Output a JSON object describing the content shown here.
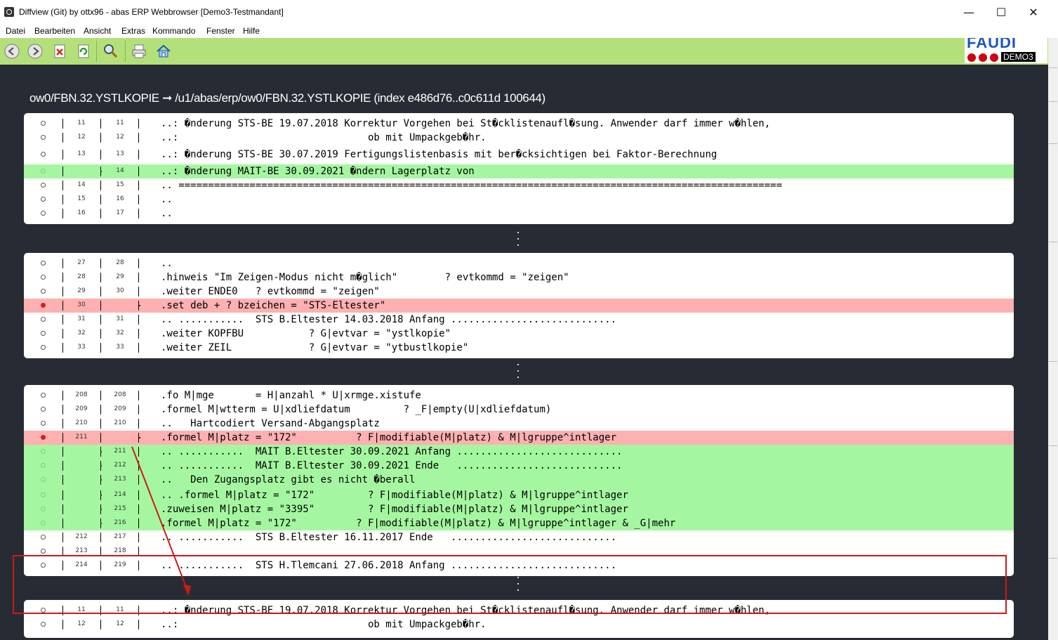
{
  "window": {
    "title": "Diffview (Git) by ottx96 - abas ERP Webbrowser  [Demo3-Testmandant]",
    "minimize_glyph": "—",
    "maximize_glyph": "☐",
    "close_glyph": "✕"
  },
  "menu": [
    "Datei",
    "Bearbeiten",
    "Ansicht",
    "Extras",
    "Kommando",
    "Fenster",
    "Hilfe"
  ],
  "toolbar": {
    "buttons": [
      "back-icon",
      "forward-icon",
      "delete-document-icon",
      "refresh-icon",
      "search-icon",
      "print-icon",
      "home-icon"
    ],
    "logo_text": "FAUDI",
    "logo_badge": "DEMO3"
  },
  "diff": {
    "title": "ow0/FBN.32.YSTLKOPIE ➞ /u1/abas/erp/ow0/FBN.32.YSTLKOPIE (index e486d76..c0c611d 100644)",
    "hunks": [
      {
        "lines": [
          {
            "type": "ctx",
            "old": "11",
            "new": "11",
            "code": "..: �nderung STS-BE 19.07.2018 Korrektur Vorgehen bei St�cklistenaufl�sung. Anwender darf immer w�hlen,"
          },
          {
            "type": "ctx",
            "old": "12",
            "new": "12",
            "code": "..:                                ob mit Umpackgeb�hr."
          },
          {
            "type": "ctx",
            "old": "13",
            "new": "13",
            "code": "..: �nderung STS-BE 30.07.2019 Fertigungslistenbasis mit ber�cksichtigen bei Faktor-Berechnung"
          },
          {
            "type": "add",
            "old": "",
            "new": "14",
            "code": "..: �nderung MAIT-BE 30.09.2021 �ndern Lagerplatz von"
          },
          {
            "type": "ctx",
            "old": "14",
            "new": "15",
            "code": ".. ======================================================================================================"
          },
          {
            "type": "ctx",
            "old": "15",
            "new": "16",
            "code": ".."
          },
          {
            "type": "ctx",
            "old": "16",
            "new": "17",
            "code": ".."
          }
        ]
      },
      {
        "lines": [
          {
            "type": "ctx",
            "old": "27",
            "new": "28",
            "code": ".."
          },
          {
            "type": "ctx",
            "old": "28",
            "new": "29",
            "code": ".hinweis \"Im Zeigen-Modus nicht m�glich\"        ? evtkommd = \"zeigen\""
          },
          {
            "type": "ctx",
            "old": "29",
            "new": "30",
            "code": ".weiter ENDE0   ? evtkommd = \"zeigen\""
          },
          {
            "type": "del",
            "old": "30",
            "new": "",
            "code": ".set deb + ? bzeichen = \"STS-Eltester\""
          },
          {
            "type": "ctx",
            "old": "31",
            "new": "31",
            "code": ".. ...........  STS B.Eltester 14.03.2018 Anfang ............................"
          },
          {
            "type": "ctx",
            "old": "32",
            "new": "32",
            "code": ".weiter KOPFBU           ? G|evtvar = \"ystlkopie\""
          },
          {
            "type": "ctx",
            "old": "33",
            "new": "33",
            "code": ".weiter ZEIL             ? G|evtvar = \"ytbustlkopie\""
          }
        ]
      },
      {
        "lines": [
          {
            "type": "ctx",
            "old": "208",
            "new": "208",
            "code": ".fo M|mge       = H|anzahl * U|xrmge.xistufe"
          },
          {
            "type": "ctx",
            "old": "209",
            "new": "209",
            "code": ".formel M|wtterm = U|xdliefdatum         ? _F|empty(U|xdliefdatum)"
          },
          {
            "type": "ctx",
            "old": "210",
            "new": "210",
            "code": "..   Hartcodiert Versand-Abgangsplatz"
          },
          {
            "type": "del",
            "old": "211",
            "new": "",
            "code": ".formel M|platz = \"172\"          ? F|modifiable(M|platz) & M|lgruppe^intlager"
          },
          {
            "type": "add",
            "old": "",
            "new": "211",
            "code": ".. ...........  MAIT B.Eltester 30.09.2021 Anfang ............................"
          },
          {
            "type": "add",
            "old": "",
            "new": "212",
            "code": ".. ...........  MAIT B.Eltester 30.09.2021 Ende   ............................"
          },
          {
            "type": "add",
            "old": "",
            "new": "213",
            "code": "..   Den Zugangsplatz gibt es nicht �berall"
          },
          {
            "type": "add",
            "old": "",
            "new": "214",
            "code": ".. .formel M|platz = \"172\"         ? F|modifiable(M|platz) & M|lgruppe^intlager"
          },
          {
            "type": "add",
            "old": "",
            "new": "215",
            "code": ".zuweisen M|platz = \"3395\"         ? F|modifiable(M|platz) & M|lgruppe^intlager"
          },
          {
            "type": "add",
            "old": "",
            "new": "216",
            "code": ".formel M|platz = \"172\"          ? F|modifiable(M|platz) & M|lgruppe^intlager & _G|mehr"
          },
          {
            "type": "ctx",
            "old": "212",
            "new": "217",
            "code": ".. ...........  STS B.Eltester 16.11.2017 Ende   ............................"
          },
          {
            "type": "ctx",
            "old": "213",
            "new": "218",
            "code": ""
          },
          {
            "type": "ctx",
            "old": "214",
            "new": "219",
            "code": ".. ...........  STS H.Tlemcani 27.06.2018 Anfang ............................"
          }
        ]
      },
      {
        "lines": [
          {
            "type": "ctx",
            "old": "11",
            "new": "11",
            "code": "..: �nderung STS-BE 19.07.2018 Korrektur Vorgehen bei St�cklistenaufl�sung. Anwender darf immer w�hlen,"
          },
          {
            "type": "ctx",
            "old": "12",
            "new": "12",
            "code": "..:                                ob mit Umpackgeb�hr."
          }
        ]
      }
    ]
  },
  "colors": {
    "added": "#a4f7a0",
    "removed": "#ffb0b0",
    "background": "#272c34",
    "annotation": "#d01818"
  }
}
